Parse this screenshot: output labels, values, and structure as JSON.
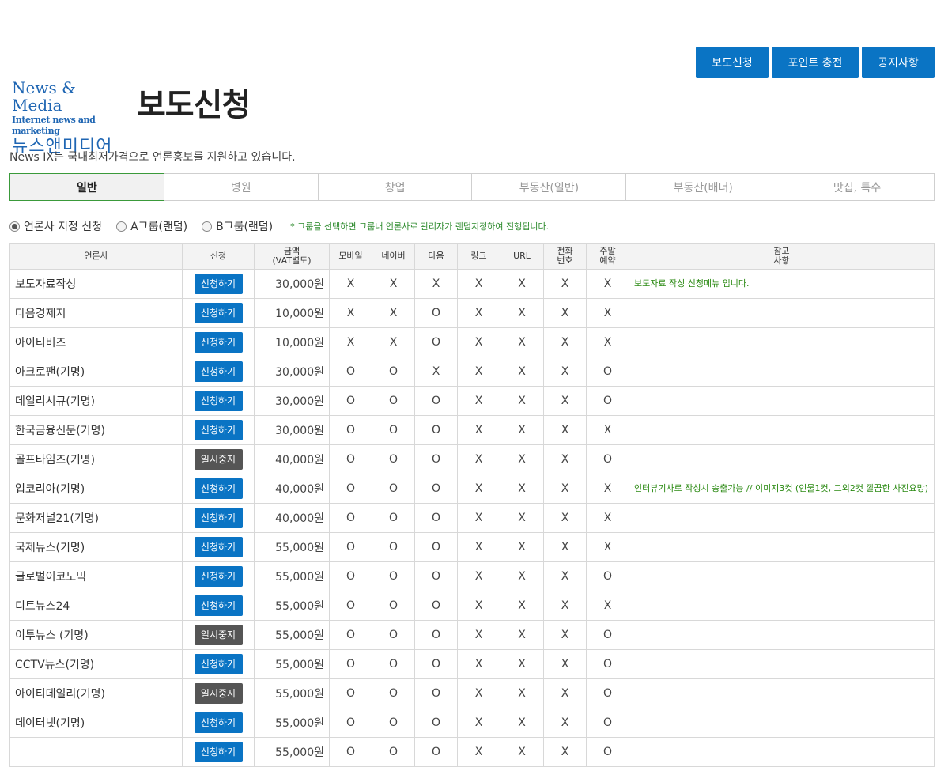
{
  "top_nav": [
    "보도신청",
    "포인트 충전",
    "공지사항"
  ],
  "logo": {
    "line1": "News & Media",
    "line2": "Internet news and marketing",
    "line3": "뉴스앤미디어"
  },
  "page_title": "보도신청",
  "description": "News IX는 국내최저가격으로 언론홍보를 지원하고 있습니다.",
  "tabs": [
    "일반",
    "병원",
    "창업",
    "부동산(일반)",
    "부동산(배너)",
    "맛집, 특수"
  ],
  "active_tab": "일반",
  "options": {
    "radio1": "언론사 지정 신청",
    "radio2": "A그룹(랜덤)",
    "radio3": "B그룹(랜덤)",
    "selected": "언론사 지정 신청"
  },
  "hint": "* 그룹을 선택하면 그룹내 언론사로 관리자가 랜덤지정하여 진행됩니다.",
  "colors": {
    "primary": "#0a74c4",
    "paused": "#555555",
    "note": "#2b8a13",
    "active_tab_border": "#3a9a3a"
  },
  "table": {
    "headers": {
      "outlet": "언론사",
      "apply": "신청",
      "price1": "금액",
      "price2": "(VAT별도)",
      "mobile": "모바일",
      "naver": "네이버",
      "daum": "다음",
      "link": "링크",
      "url": "URL",
      "phone1": "전화",
      "phone2": "번호",
      "weekend1": "주말",
      "weekend2": "예약",
      "note1": "참고",
      "note2": "사항"
    },
    "rows": [
      {
        "name": "보도자료작성",
        "btn": "신청하기",
        "paused": false,
        "price": "30,000원",
        "m": "X",
        "n": "X",
        "d": "X",
        "l": "X",
        "u": "X",
        "p": "X",
        "w": "X",
        "note": "보도자료 작성 신청메뉴 입니다."
      },
      {
        "name": "다음경제지",
        "btn": "신청하기",
        "paused": false,
        "price": "10,000원",
        "m": "X",
        "n": "X",
        "d": "O",
        "l": "X",
        "u": "X",
        "p": "X",
        "w": "X",
        "note": ""
      },
      {
        "name": "아이티비즈",
        "btn": "신청하기",
        "paused": false,
        "price": "10,000원",
        "m": "X",
        "n": "X",
        "d": "O",
        "l": "X",
        "u": "X",
        "p": "X",
        "w": "X",
        "note": ""
      },
      {
        "name": "아크로팬(기명)",
        "btn": "신청하기",
        "paused": false,
        "price": "30,000원",
        "m": "O",
        "n": "O",
        "d": "X",
        "l": "X",
        "u": "X",
        "p": "X",
        "w": "O",
        "note": ""
      },
      {
        "name": "데일리시큐(기명)",
        "btn": "신청하기",
        "paused": false,
        "price": "30,000원",
        "m": "O",
        "n": "O",
        "d": "O",
        "l": "X",
        "u": "X",
        "p": "X",
        "w": "O",
        "note": ""
      },
      {
        "name": "한국금융신문(기명)",
        "btn": "신청하기",
        "paused": false,
        "price": "30,000원",
        "m": "O",
        "n": "O",
        "d": "O",
        "l": "X",
        "u": "X",
        "p": "X",
        "w": "X",
        "note": ""
      },
      {
        "name": "골프타임즈(기명)",
        "btn": "일시중지",
        "paused": true,
        "price": "40,000원",
        "m": "O",
        "n": "O",
        "d": "O",
        "l": "X",
        "u": "X",
        "p": "X",
        "w": "O",
        "note": ""
      },
      {
        "name": "업코리아(기명)",
        "btn": "신청하기",
        "paused": false,
        "price": "40,000원",
        "m": "O",
        "n": "O",
        "d": "O",
        "l": "X",
        "u": "X",
        "p": "X",
        "w": "X",
        "note": "인터뷰기사로 작성시 송출가능 // 이미지3컷 (인물1컷, 그외2컷 깔끔한 사진요망)"
      },
      {
        "name": "문화저널21(기명)",
        "btn": "신청하기",
        "paused": false,
        "price": "40,000원",
        "m": "O",
        "n": "O",
        "d": "O",
        "l": "X",
        "u": "X",
        "p": "X",
        "w": "X",
        "note": ""
      },
      {
        "name": "국제뉴스(기명)",
        "btn": "신청하기",
        "paused": false,
        "price": "55,000원",
        "m": "O",
        "n": "O",
        "d": "O",
        "l": "X",
        "u": "X",
        "p": "X",
        "w": "X",
        "note": ""
      },
      {
        "name": "글로벌이코노믹",
        "btn": "신청하기",
        "paused": false,
        "price": "55,000원",
        "m": "O",
        "n": "O",
        "d": "O",
        "l": "X",
        "u": "X",
        "p": "X",
        "w": "O",
        "note": ""
      },
      {
        "name": "디트뉴스24",
        "btn": "신청하기",
        "paused": false,
        "price": "55,000원",
        "m": "O",
        "n": "O",
        "d": "O",
        "l": "X",
        "u": "X",
        "p": "X",
        "w": "X",
        "note": ""
      },
      {
        "name": "이투뉴스 (기명)",
        "btn": "일시중지",
        "paused": true,
        "price": "55,000원",
        "m": "O",
        "n": "O",
        "d": "O",
        "l": "X",
        "u": "X",
        "p": "X",
        "w": "O",
        "note": ""
      },
      {
        "name": "CCTV뉴스(기명)",
        "btn": "신청하기",
        "paused": false,
        "price": "55,000원",
        "m": "O",
        "n": "O",
        "d": "O",
        "l": "X",
        "u": "X",
        "p": "X",
        "w": "O",
        "note": ""
      },
      {
        "name": "아이티데일리(기명)",
        "btn": "일시중지",
        "paused": true,
        "price": "55,000원",
        "m": "O",
        "n": "O",
        "d": "O",
        "l": "X",
        "u": "X",
        "p": "X",
        "w": "O",
        "note": ""
      },
      {
        "name": "데이터넷(기명)",
        "btn": "신청하기",
        "paused": false,
        "price": "55,000원",
        "m": "O",
        "n": "O",
        "d": "O",
        "l": "X",
        "u": "X",
        "p": "X",
        "w": "O",
        "note": ""
      },
      {
        "name": "",
        "btn": "신청하기",
        "paused": false,
        "price": "55,000원",
        "m": "O",
        "n": "O",
        "d": "O",
        "l": "X",
        "u": "X",
        "p": "X",
        "w": "O",
        "note": ""
      }
    ]
  }
}
